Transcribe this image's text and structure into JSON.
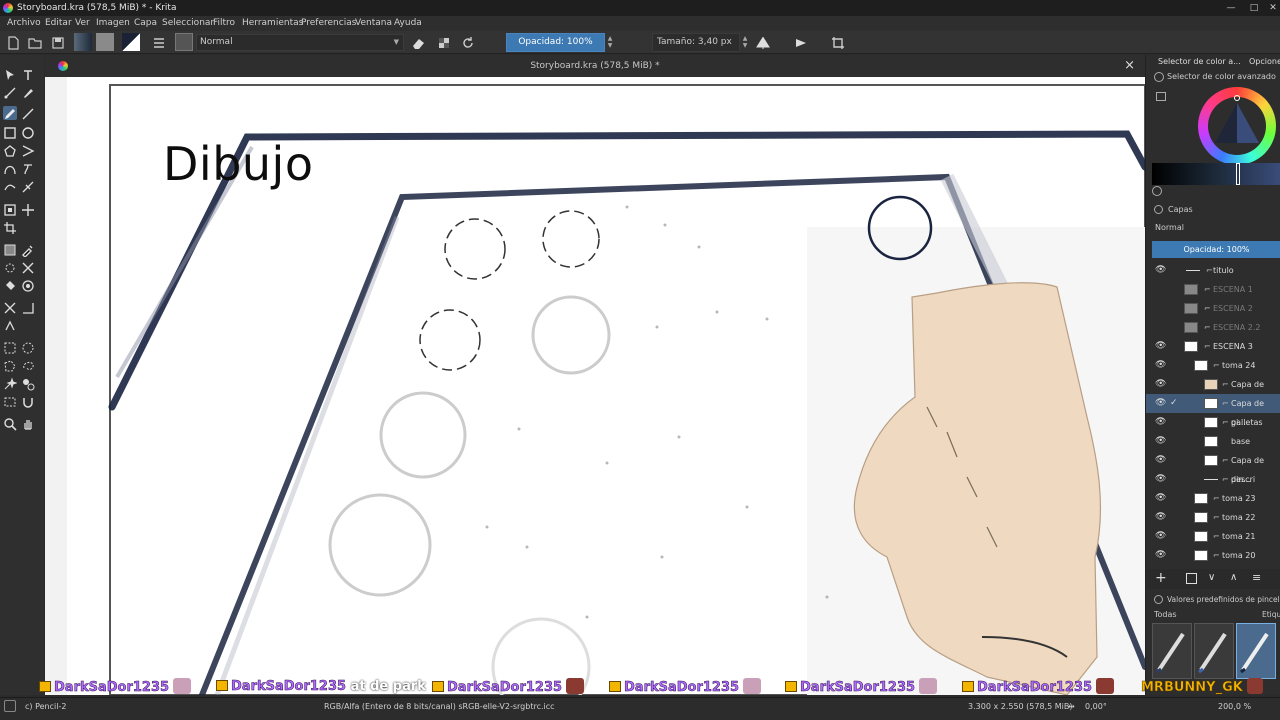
{
  "window": {
    "title": "Storyboard.kra (578,5 MiB) * - Krita",
    "controls": [
      "—",
      "□",
      "✕"
    ]
  },
  "menu": [
    "Archivo",
    "Editar",
    "Ver",
    "Imagen",
    "Capa",
    "Seleccionar",
    "Filtro",
    "Herramientas",
    "Preferencias",
    "Ventana",
    "Ayuda"
  ],
  "toolbar": {
    "blend_mode": "Normal",
    "opacity_label": "Opacidad: 100%",
    "size_label": "Tamaño: 3,40 px"
  },
  "document": {
    "tab_title": "Storyboard.kra (578,5 MiB) *",
    "close": "×",
    "canvas_heading": "Dibujo"
  },
  "dock": {
    "tabs": [
      "Selector de color a...",
      "Opcione"
    ],
    "color_selector_title": "Selector de color avanzado",
    "layers_title": "Capas",
    "blend_mode": "Normal",
    "layer_opacity": "Opacidad:  100%",
    "layers": [
      {
        "name": "titulo",
        "visible": true,
        "dim": false,
        "depth": 0
      },
      {
        "name": "ESCENA 1",
        "visible": false,
        "dim": true,
        "depth": 0
      },
      {
        "name": "ESCENA 2",
        "visible": false,
        "dim": true,
        "depth": 0
      },
      {
        "name": "ESCENA 2.2",
        "visible": false,
        "dim": true,
        "depth": 0
      },
      {
        "name": "ESCENA 3",
        "visible": true,
        "dim": false,
        "depth": 0
      },
      {
        "name": "toma 24",
        "visible": true,
        "dim": false,
        "depth": 1
      },
      {
        "name": "Capa de pin...",
        "visible": true,
        "dim": false,
        "depth": 2
      },
      {
        "name": "Capa de pi...",
        "visible": true,
        "dim": false,
        "depth": 2,
        "selected": true
      },
      {
        "name": "galletas",
        "visible": true,
        "dim": false,
        "depth": 2
      },
      {
        "name": "base",
        "visible": true,
        "dim": false,
        "depth": 2
      },
      {
        "name": "Capa de pin...",
        "visible": true,
        "dim": false,
        "depth": 2
      },
      {
        "name": "descri",
        "visible": true,
        "dim": false,
        "depth": 1
      },
      {
        "name": "toma 23",
        "visible": true,
        "dim": false,
        "depth": 1
      },
      {
        "name": "toma 22",
        "visible": true,
        "dim": false,
        "depth": 1
      },
      {
        "name": "toma 21",
        "visible": true,
        "dim": false,
        "depth": 1
      },
      {
        "name": "toma 20",
        "visible": true,
        "dim": false,
        "depth": 1
      }
    ],
    "brush_presets_title": "Valores predefinidos de pincel",
    "brush_filter": "Todas",
    "brush_tag": "Etique"
  },
  "chat": [
    {
      "name": "DarkSaDor1235",
      "msg": ""
    },
    {
      "name": "DarkSaDor1235",
      "msg": "at de park"
    },
    {
      "name": "DarkSaDor1235",
      "msg": ""
    },
    {
      "name": "DarkSaDor1235",
      "msg": ""
    },
    {
      "name": "DarkSaDor1235",
      "msg": ""
    },
    {
      "name": "DarkSaDor1235",
      "msg": ""
    },
    {
      "name": "MRBUNNY_GK",
      "msg": ""
    }
  ],
  "status": {
    "brush": "c) Pencil-2",
    "color_space": "RGB/Alfa (Entero de 8 bits/canal)  sRGB-elle-V2-srgbtrc.icc",
    "dimensions": "3.300 x 2.550 (578,5 MiB)",
    "rotation": "0,00°",
    "zoom": "200,0 %"
  },
  "colors": {
    "accent": "#3d7ab3",
    "selected_layer": "#405a78",
    "skin": "#efd9c0",
    "ink": "#1a2440",
    "chat_name": "#b06cff"
  }
}
